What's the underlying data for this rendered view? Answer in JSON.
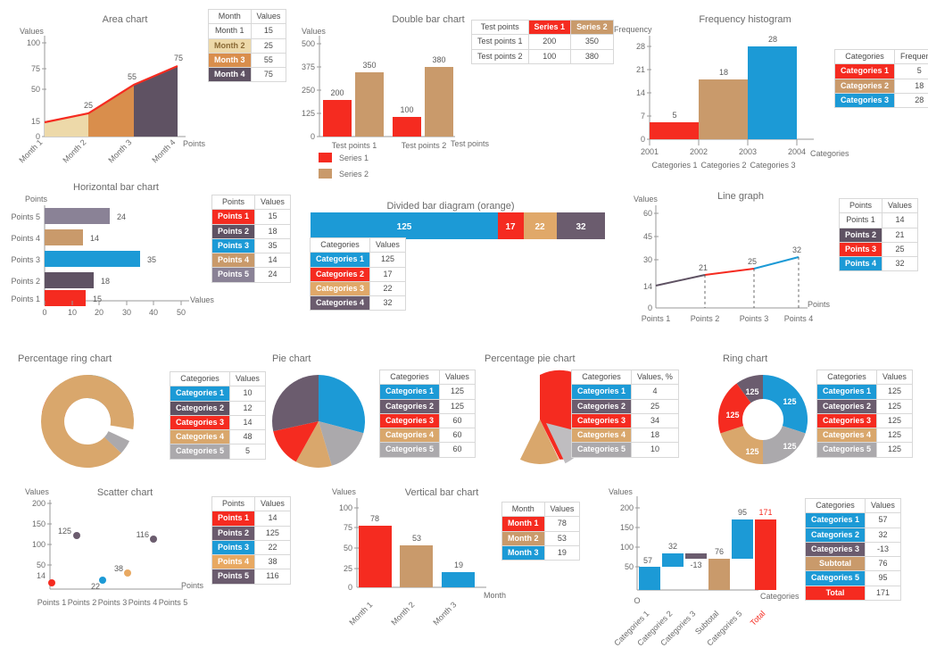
{
  "palette": {
    "red": "#F52B20",
    "blue": "#1C9AD6",
    "tan": "#C99A6B",
    "purple": "#5F5263",
    "gray": "#ABA9AC",
    "grayPurple": "#8A8296",
    "cream": "#EDD9A9",
    "orange": "#D98E4C",
    "axis": "#9a9a9a",
    "text": "#5a5a5a"
  },
  "charts": [
    {
      "id": "area-chart",
      "chart_data": {
        "type": "area",
        "title": "Area chart",
        "xlabel": "Points",
        "ylabel": "Values",
        "categories": [
          "Month 1",
          "Month 2",
          "Month 3",
          "Month 4"
        ],
        "values": [
          15,
          25,
          55,
          75
        ],
        "ylim": [
          0,
          100
        ],
        "yticks": [
          0,
          15,
          50,
          75,
          100
        ],
        "grid": false,
        "segment_colors": [
          "#EDD9A9",
          "#D98E4C",
          "#5F5263"
        ],
        "line_color": "#F52B20",
        "table": {
          "headers": [
            "Month",
            "Values"
          ],
          "rows": [
            {
              "label": "Month 1",
              "value": "15",
              "color": "#FFFFFF",
              "text": "#4a4a4a"
            },
            {
              "label": "Month 2",
              "value": "25",
              "color": "#EDD9A9",
              "text": "#7a5a2a"
            },
            {
              "label": "Month 3",
              "value": "55",
              "color": "#D98E4C",
              "text": "#ffffff"
            },
            {
              "label": "Month 4",
              "value": "75",
              "color": "#5F5263",
              "text": "#ffffff"
            }
          ]
        }
      }
    },
    {
      "id": "double-bar-chart",
      "chart_data": {
        "type": "bar",
        "title": "Double bar chart",
        "xlabel": "Test points",
        "ylabel": "Values",
        "categories": [
          "Test points 1",
          "Test points 2"
        ],
        "series": [
          {
            "name": "Series 1",
            "values": [
              200,
              100
            ],
            "color": "#F52B20"
          },
          {
            "name": "Series 2",
            "values": [
              350,
              380
            ],
            "color": "#C99A6B"
          }
        ],
        "ylim": [
          0,
          500
        ],
        "yticks": [
          0,
          125,
          250,
          375,
          500
        ],
        "legend_position": "bottom-left",
        "table": {
          "headers": [
            "Test points",
            "Series 1",
            "Series 2"
          ],
          "header_colors": [
            "#FFFFFF",
            "#F52B20",
            "#C99A6B"
          ],
          "rows": [
            {
              "label": "Test points 1",
              "v1": "200",
              "v2": "350"
            },
            {
              "label": "Test points 2",
              "v1": "100",
              "v2": "380"
            }
          ]
        }
      }
    },
    {
      "id": "frequency-histogram",
      "chart_data": {
        "type": "bar",
        "title": "Frequency histogram",
        "xlabel": "Categories",
        "ylabel": "Frequency",
        "x": [
          "2001",
          "2002",
          "2003",
          "2004"
        ],
        "categories": [
          "Categories 1",
          "Categories 2",
          "Categories 3"
        ],
        "values": [
          5,
          18,
          28
        ],
        "colors": [
          "#F52B20",
          "#C99A6B",
          "#1C9AD6"
        ],
        "ylim": [
          0,
          28
        ],
        "yticks": [
          0,
          7,
          14,
          21,
          28
        ],
        "table": {
          "headers": [
            "Categories",
            "Frequency"
          ],
          "rows": [
            {
              "label": "Categories 1",
              "value": "5",
              "color": "#F52B20"
            },
            {
              "label": "Categories 2",
              "value": "18",
              "color": "#C99A6B"
            },
            {
              "label": "Categories 3",
              "value": "28",
              "color": "#1C9AD6"
            }
          ]
        }
      }
    },
    {
      "id": "horizontal-bar-chart",
      "chart_data": {
        "type": "bar",
        "orientation": "horizontal",
        "title": "Horizontal bar chart",
        "xlabel": "Values",
        "ylabel": "Points",
        "categories": [
          "Points 1",
          "Points 2",
          "Points 3",
          "Points 4",
          "Points 5"
        ],
        "values": [
          15,
          18,
          35,
          14,
          24
        ],
        "colors": [
          "#F52B20",
          "#5F5263",
          "#1C9AD6",
          "#C99A6B",
          "#8A8296"
        ],
        "xlim": [
          0,
          55
        ],
        "xticks": [
          0,
          10,
          20,
          30,
          40,
          50
        ],
        "table": {
          "headers": [
            "Points",
            "Values"
          ],
          "rows": [
            {
              "label": "Points 1",
              "value": "15",
              "color": "#F52B20"
            },
            {
              "label": "Points 2",
              "value": "18",
              "color": "#5F5263"
            },
            {
              "label": "Points 3",
              "value": "35",
              "color": "#1C9AD6"
            },
            {
              "label": "Points 4",
              "value": "14",
              "color": "#C99A6B"
            },
            {
              "label": "Points 5",
              "value": "24",
              "color": "#8A8296"
            }
          ]
        }
      }
    },
    {
      "id": "divided-bar-diagram",
      "chart_data": {
        "type": "bar",
        "orientation": "stacked-horizontal",
        "title": "Divided bar diagram (orange)",
        "categories": [
          "Categories 1",
          "Categories 2",
          "Categories 3",
          "Categories 4"
        ],
        "values": [
          125,
          17,
          22,
          32
        ],
        "colors": [
          "#1C9AD6",
          "#F52B20",
          "#E0A869",
          "#6B5C6E"
        ],
        "table": {
          "headers": [
            "Categories",
            "Values"
          ],
          "rows": [
            {
              "label": "Categories 1",
              "value": "125",
              "color": "#1C9AD6"
            },
            {
              "label": "Categories 2",
              "value": "17",
              "color": "#F52B20"
            },
            {
              "label": "Categories 3",
              "value": "22",
              "color": "#E0A869"
            },
            {
              "label": "Categories 4",
              "value": "32",
              "color": "#6B5C6E"
            }
          ]
        }
      }
    },
    {
      "id": "line-graph",
      "chart_data": {
        "type": "line",
        "title": "Line graph",
        "xlabel": "Points",
        "ylabel": "Values",
        "categories": [
          "Points 1",
          "Points 2",
          "Points 3",
          "Points 4"
        ],
        "values": [
          14,
          21,
          25,
          32
        ],
        "segment_colors": [
          "#5F5263",
          "#F52B20",
          "#1C9AD6"
        ],
        "ylim": [
          0,
          60
        ],
        "yticks": [
          0,
          14,
          30,
          45,
          60
        ],
        "table": {
          "headers": [
            "Points",
            "Values"
          ],
          "rows": [
            {
              "label": "Points 1",
              "value": "14",
              "color": "#FFFFFF",
              "text": "#4a4a4a"
            },
            {
              "label": "Points 2",
              "value": "21",
              "color": "#5F5263",
              "text": "#ffffff"
            },
            {
              "label": "Points 3",
              "value": "25",
              "color": "#F52B20",
              "text": "#ffffff"
            },
            {
              "label": "Points 4",
              "value": "32",
              "color": "#1C9AD6",
              "text": "#ffffff"
            }
          ]
        }
      }
    },
    {
      "id": "percentage-ring-chart",
      "chart_data": {
        "type": "pie",
        "variant": "ring",
        "title": "Percentage ring chart",
        "categories": [
          "Categories 1",
          "Categories 2",
          "Categories 3",
          "Categories 4",
          "Categories 5"
        ],
        "values": [
          10,
          12,
          14,
          48,
          5
        ],
        "colors": [
          "#1C9AD6",
          "#5F5263",
          "#F52B20",
          "#D9A76C",
          "#ABA9AC"
        ],
        "table": {
          "headers": [
            "Categories",
            "Values"
          ],
          "rows": [
            {
              "label": "Categories 1",
              "value": "10",
              "color": "#1C9AD6"
            },
            {
              "label": "Categories 2",
              "value": "12",
              "color": "#5F5263"
            },
            {
              "label": "Categories 3",
              "value": "14",
              "color": "#F52B20"
            },
            {
              "label": "Categories 4",
              "value": "48",
              "color": "#D9A76C"
            },
            {
              "label": "Categories 5",
              "value": "5",
              "color": "#ABA9AC"
            }
          ]
        }
      }
    },
    {
      "id": "pie-chart",
      "chart_data": {
        "type": "pie",
        "title": "Pie chart",
        "categories": [
          "Categories 1",
          "Categories 2",
          "Categories 3",
          "Categories 4",
          "Categories 5"
        ],
        "values": [
          125,
          125,
          60,
          60,
          60
        ],
        "colors": [
          "#1C9AD6",
          "#6B5C6E",
          "#F52B20",
          "#D9A76C",
          "#ABA9AC"
        ],
        "table": {
          "headers": [
            "Categories",
            "Values"
          ],
          "rows": [
            {
              "label": "Categories 1",
              "value": "125",
              "color": "#1C9AD6"
            },
            {
              "label": "Categories 2",
              "value": "125",
              "color": "#6B5C6E"
            },
            {
              "label": "Categories 3",
              "value": "60",
              "color": "#F52B20"
            },
            {
              "label": "Categories 4",
              "value": "60",
              "color": "#D9A76C"
            },
            {
              "label": "Categories 5",
              "value": "60",
              "color": "#ABA9AC"
            }
          ]
        }
      }
    },
    {
      "id": "percentage-pie-chart",
      "chart_data": {
        "type": "pie",
        "title": "Percentage pie chart",
        "categories": [
          "Categories 1",
          "Categories 2",
          "Categories 3",
          "Categories 4",
          "Categories 5"
        ],
        "values": [
          4,
          25,
          34,
          18,
          10
        ],
        "unit": "%",
        "exploded": [
          "Categories 5"
        ],
        "colors": [
          "#1C9AD6",
          "#6B5C6E",
          "#F52B20",
          "#D9A76C",
          "#BFBDC0"
        ],
        "table": {
          "headers": [
            "Categories",
            "Values, %"
          ],
          "rows": [
            {
              "label": "Categories 1",
              "value": "4",
              "color": "#1C9AD6"
            },
            {
              "label": "Categories 2",
              "value": "25",
              "color": "#6B5C6E"
            },
            {
              "label": "Categories 3",
              "value": "34",
              "color": "#F52B20"
            },
            {
              "label": "Categories 4",
              "value": "18",
              "color": "#D9A76C"
            },
            {
              "label": "Categories 5",
              "value": "10",
              "color": "#ABA9AC"
            }
          ]
        }
      }
    },
    {
      "id": "ring-chart",
      "chart_data": {
        "type": "pie",
        "variant": "ring",
        "title": "Ring chart",
        "categories": [
          "Categories 1",
          "Categories 2",
          "Categories 3",
          "Categories 4",
          "Categories 5"
        ],
        "values": [
          125,
          125,
          125,
          125,
          125
        ],
        "colors": [
          "#1C9AD6",
          "#6B5C6E",
          "#F52B20",
          "#D9A76C",
          "#ABA9AC"
        ],
        "table": {
          "headers": [
            "Categories",
            "Values"
          ],
          "rows": [
            {
              "label": "Categories 1",
              "value": "125",
              "color": "#1C9AD6"
            },
            {
              "label": "Categories 2",
              "value": "125",
              "color": "#6B5C6E"
            },
            {
              "label": "Categories 3",
              "value": "125",
              "color": "#F52B20"
            },
            {
              "label": "Categories 4",
              "value": "125",
              "color": "#D9A76C"
            },
            {
              "label": "Categories 5",
              "value": "125",
              "color": "#ABA9AC"
            }
          ]
        }
      }
    },
    {
      "id": "scatter-chart",
      "chart_data": {
        "type": "scatter",
        "title": "Scatter chart",
        "xlabel": "Points",
        "ylabel": "Values",
        "categories": [
          "Points 1",
          "Points 2",
          "Points 3",
          "Points 4",
          "Points 5"
        ],
        "values": [
          14,
          125,
          22,
          38,
          116
        ],
        "colors": [
          "#F52B20",
          "#6B5C6E",
          "#1C9AD6",
          "#E8A962",
          "#6B5C6E"
        ],
        "ylim": [
          0,
          215
        ],
        "yticks": [
          14,
          50,
          100,
          150,
          200
        ],
        "table": {
          "headers": [
            "Points",
            "Values"
          ],
          "rows": [
            {
              "label": "Points 1",
              "value": "14",
              "color": "#F52B20"
            },
            {
              "label": "Points 2",
              "value": "125",
              "color": "#6B5C6E"
            },
            {
              "label": "Points 3",
              "value": "22",
              "color": "#1C9AD6"
            },
            {
              "label": "Points 4",
              "value": "38",
              "color": "#E8A962"
            },
            {
              "label": "Points 5",
              "value": "116",
              "color": "#6B5C6E"
            }
          ]
        }
      }
    },
    {
      "id": "vertical-bar-chart",
      "chart_data": {
        "type": "bar",
        "title": "Vertical bar chart",
        "xlabel": "Month",
        "ylabel": "Values",
        "categories": [
          "Month 1",
          "Month 2",
          "Month 3"
        ],
        "values": [
          78,
          53,
          19
        ],
        "colors": [
          "#F52B20",
          "#C99A6B",
          "#1C9AD6"
        ],
        "ylim": [
          0,
          100
        ],
        "yticks": [
          0,
          25,
          50,
          75,
          100
        ],
        "table": {
          "headers": [
            "Month",
            "Values"
          ],
          "rows": [
            {
              "label": "Month 1",
              "value": "78",
              "color": "#F52B20"
            },
            {
              "label": "Month 2",
              "value": "53",
              "color": "#C99A6B"
            },
            {
              "label": "Month 3",
              "value": "19",
              "color": "#1C9AD6"
            }
          ]
        }
      }
    },
    {
      "id": "waterfall-chart",
      "chart_data": {
        "type": "bar",
        "variant": "waterfall",
        "title": "",
        "xlabel": "Categories",
        "ylabel": "Values",
        "origin_label": "O",
        "categories": [
          "Categories 1",
          "Categories 2",
          "Categories 3",
          "Subtotal",
          "Categories 5",
          "Total"
        ],
        "values": [
          57,
          32,
          -13,
          76,
          95,
          171
        ],
        "bases": [
          0,
          57,
          76,
          0,
          76,
          0
        ],
        "colors": [
          "#1C9AD6",
          "#1C9AD6",
          "#6B5C6E",
          "#C99A6B",
          "#1C9AD6",
          "#F52B20"
        ],
        "ylim": [
          0,
          215
        ],
        "yticks": [
          50,
          100,
          150,
          200
        ],
        "table": {
          "headers": [
            "Categories",
            "Values"
          ],
          "rows": [
            {
              "label": "Categories 1",
              "value": "57",
              "color": "#1C9AD6"
            },
            {
              "label": "Categories 2",
              "value": "32",
              "color": "#1C9AD6"
            },
            {
              "label": "Categories 3",
              "value": "-13",
              "color": "#6B5C6E"
            },
            {
              "label": "Subtotal",
              "value": "76",
              "color": "#C99A6B"
            },
            {
              "label": "Categories 5",
              "value": "95",
              "color": "#1C9AD6"
            },
            {
              "label": "Total",
              "value": "171",
              "color": "#F52B20"
            }
          ]
        }
      }
    }
  ]
}
